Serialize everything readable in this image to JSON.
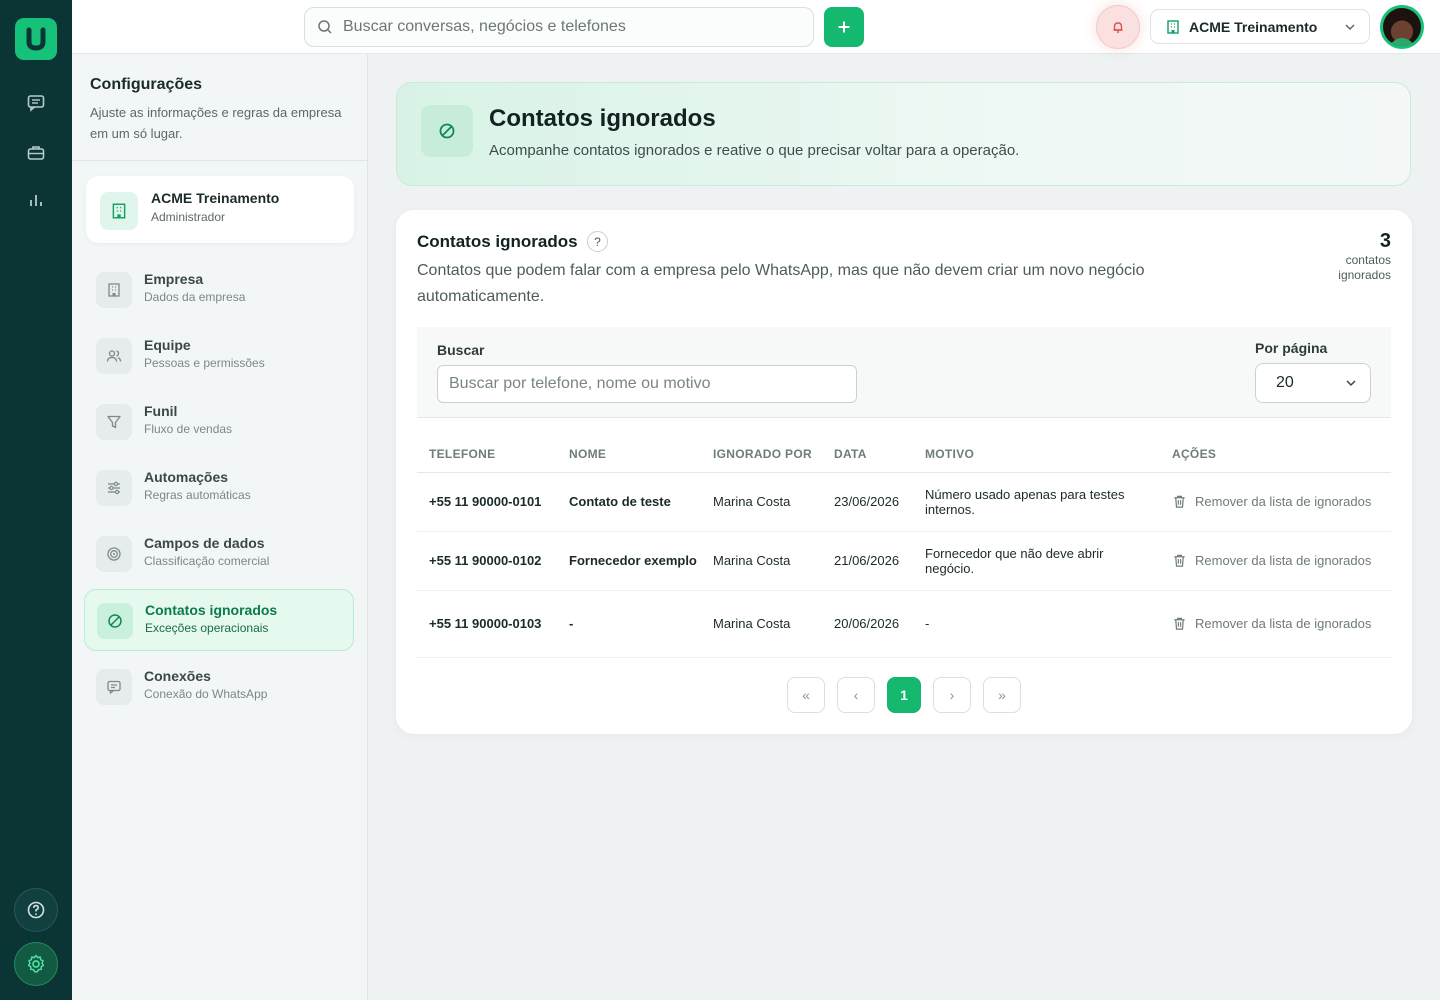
{
  "topbar": {
    "search_placeholder": "Buscar conversas, negócios e telefones",
    "company_name": "ACME Treinamento"
  },
  "rail": {
    "icons": [
      "chat-icon",
      "briefcase-icon",
      "bar-chart-icon"
    ],
    "bottom_icons": [
      "help-icon",
      "settings-icon"
    ]
  },
  "sidebar": {
    "title": "Configurações",
    "description": "Ajuste as informações e regras da empresa em um só lugar.",
    "org": {
      "name": "ACME Treinamento",
      "role": "Administrador"
    },
    "items": [
      {
        "label": "Empresa",
        "sub": "Dados da empresa",
        "icon": "building-icon"
      },
      {
        "label": "Equipe",
        "sub": "Pessoas e permissões",
        "icon": "users-icon"
      },
      {
        "label": "Funil",
        "sub": "Fluxo de vendas",
        "icon": "funnel-icon"
      },
      {
        "label": "Automações",
        "sub": "Regras automáticas",
        "icon": "sliders-icon"
      },
      {
        "label": "Campos de dados",
        "sub": "Classificação comercial",
        "icon": "target-icon"
      },
      {
        "label": "Contatos ignorados",
        "sub": "Exceções operacionais",
        "icon": "ban-icon",
        "active": true
      },
      {
        "label": "Conexões",
        "sub": "Conexão do WhatsApp",
        "icon": "message-icon"
      }
    ]
  },
  "hero": {
    "title": "Contatos ignorados",
    "subtitle": "Acompanhe contatos ignorados e reative o que precisar voltar para a operação."
  },
  "card": {
    "title": "Contatos ignorados",
    "help": "?",
    "description": "Contatos que podem falar com a empresa pelo WhatsApp, mas que não devem criar um novo negócio automaticamente.",
    "count": "3",
    "count_label": "contatos ignorados",
    "search_label": "Buscar",
    "search_placeholder": "Buscar por telefone, nome ou motivo",
    "per_page_label": "Por página",
    "per_page_value": "20"
  },
  "table": {
    "headers": [
      "TELEFONE",
      "NOME",
      "IGNORADO POR",
      "DATA",
      "MOTIVO",
      "AÇÕES"
    ],
    "rows": [
      {
        "phone": "+55 11 90000-0101",
        "name": "Contato de teste",
        "by": "Marina Costa",
        "date": "23/06/2026",
        "reason": "Número usado apenas para testes internos.",
        "action": "Remover da lista de ignorados"
      },
      {
        "phone": "+55 11 90000-0102",
        "name": "Fornecedor exemplo",
        "by": "Marina Costa",
        "date": "21/06/2026",
        "reason": "Fornecedor que não deve abrir negócio.",
        "action": "Remover da lista de ignorados"
      },
      {
        "phone": "+55 11 90000-0103",
        "name": "-",
        "by": "Marina Costa",
        "date": "20/06/2026",
        "reason": "-",
        "action": "Remover da lista de ignorados"
      }
    ]
  },
  "pagination": {
    "first": "«",
    "prev": "‹",
    "current": "1",
    "next": "›",
    "last": "»"
  },
  "colors": {
    "rail": "#0b3535",
    "accent": "#14b86f",
    "accent_light": "#e6f9ef"
  }
}
